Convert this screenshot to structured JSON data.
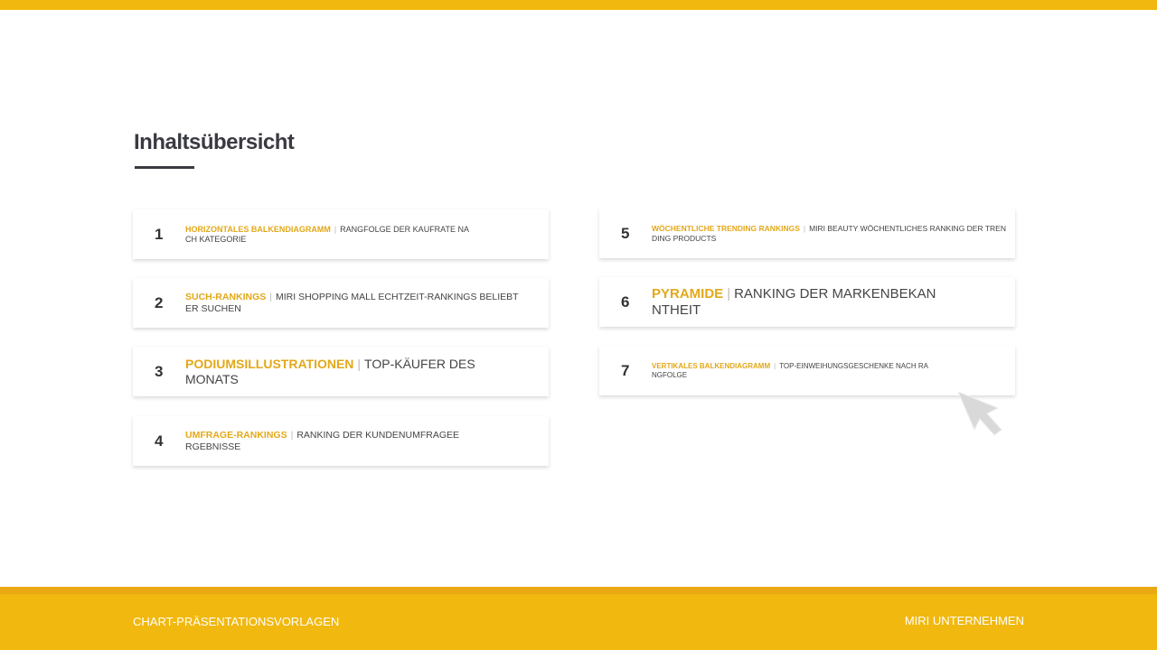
{
  "title": "Inhaltsübersicht",
  "items": [
    {
      "num": "1",
      "title": "HORIZONTALES BALKENDIAGRAMM",
      "desc1": "RANGFOLGE DER KAUFRATE NA",
      "desc2": "CH KATEGORIE"
    },
    {
      "num": "2",
      "title": "SUCH-RANKINGS",
      "desc1": "MIRI SHOPPING MALL ECHTZEIT-RANKINGS BELIEBT",
      "desc2": "ER SUCHEN"
    },
    {
      "num": "3",
      "title": "PODIUMSILLUSTRATIONEN",
      "desc1": "TOP-KÄUFER DES",
      "desc2": "MONATS"
    },
    {
      "num": "4",
      "title": "UMFRAGE-RANKINGS",
      "desc1": "RANKING DER KUNDENUMFRAGEE",
      "desc2": "RGEBNISSE"
    },
    {
      "num": "5",
      "title": "WÖCHENTLICHE TRENDING RANKINGS",
      "desc1": "MIRI BEAUTY WÖCHENTLICHES RANKING DER TREN",
      "desc2": "DING PRODUCTS"
    },
    {
      "num": "6",
      "title": "PYRAMIDE",
      "desc1": "RANKING DER MARKENBEKAN",
      "desc2": "NTHEIT"
    },
    {
      "num": "7",
      "title": "VERTIKALES BALKENDIAGRAMM",
      "desc1": "TOP-EINWEIHUNGSGESCHENKE NACH RA",
      "desc2": "NGFOLGE"
    }
  ],
  "footer": {
    "left": "CHART-PRÄSENTATIONSVORLAGEN",
    "right": "MIRI UNTERNEHMEN"
  },
  "colors": {
    "accent": "#F1B80F",
    "title_accent": "#E3A818"
  }
}
